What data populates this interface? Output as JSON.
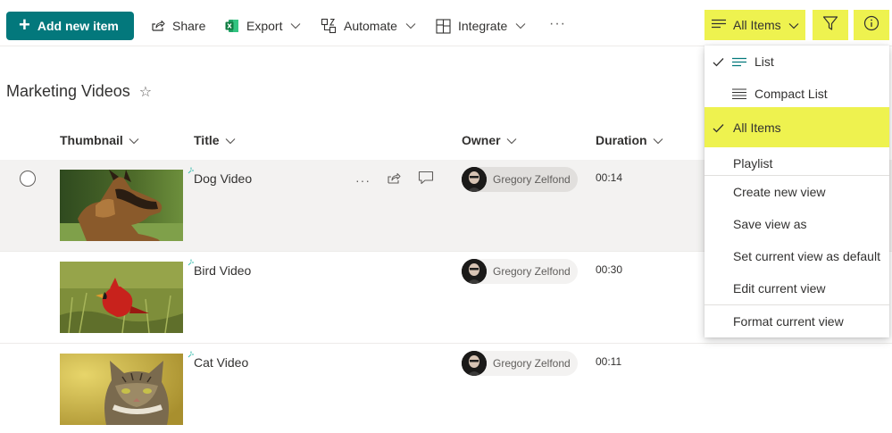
{
  "command_bar": {
    "add_label": "Add new item",
    "share_label": "Share",
    "export_label": "Export",
    "automate_label": "Automate",
    "integrate_label": "Integrate",
    "more_label": "···",
    "view_label": "All Items"
  },
  "page": {
    "title": "Marketing Videos"
  },
  "columns": {
    "thumbnail": "Thumbnail",
    "title": "Title",
    "owner": "Owner",
    "duration": "Duration"
  },
  "rows": [
    {
      "title": "Dog Video",
      "owner": "Gregory Zelfond",
      "duration": "00:14",
      "thumb_icon": "dog-photo"
    },
    {
      "title": "Bird Video",
      "owner": "Gregory Zelfond",
      "duration": "00:30",
      "thumb_icon": "cardinal-bird-photo"
    },
    {
      "title": "Cat Video",
      "owner": "Gregory Zelfond",
      "duration": "00:11",
      "thumb_icon": "tabby-cat-photo"
    }
  ],
  "menu": {
    "list": "List",
    "compact_list": "Compact List",
    "all_items": "All Items",
    "playlist": "Playlist",
    "create_view": "Create new view",
    "save_view_as": "Save view as",
    "set_default": "Set current view as default",
    "edit_view": "Edit current view",
    "format_view": "Format current view"
  },
  "colors": {
    "accent": "#03787c",
    "highlight": "#eef24f",
    "selected_row": "#f3f2f1",
    "new_mark": "#3fbfb1"
  }
}
